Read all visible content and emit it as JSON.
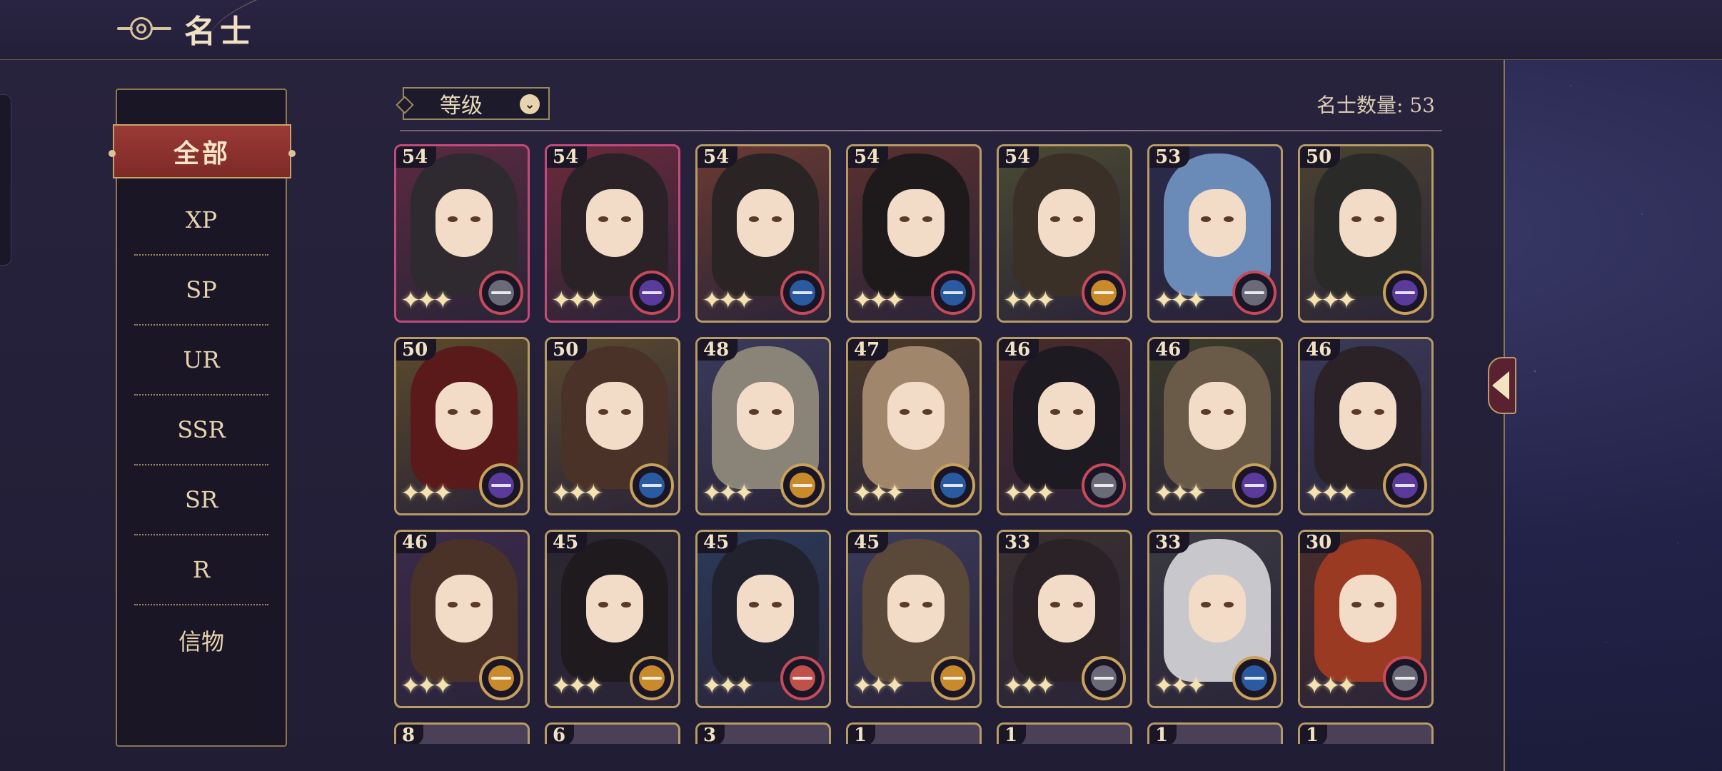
{
  "header": {
    "title": "名士"
  },
  "sidebar": {
    "items": [
      {
        "label": "全部",
        "active": true
      },
      {
        "label": "XP"
      },
      {
        "label": "SP"
      },
      {
        "label": "UR"
      },
      {
        "label": "SSR"
      },
      {
        "label": "SR"
      },
      {
        "label": "R"
      },
      {
        "label": "信物"
      }
    ]
  },
  "sort": {
    "label": "等级",
    "icon": "chevron-down-icon"
  },
  "count": {
    "text": "名士数量: 53"
  },
  "colors": {
    "accent": "#b79b64",
    "active_tab": "#8a302c",
    "badge_types": {
      "grey": "#6a6a78",
      "purple": "#5a3a9a",
      "blue": "#2a5aa0",
      "gold": "#c88a2a",
      "red": "#c0504a"
    }
  },
  "cards": [
    {
      "level": "54",
      "frame": "#c44a7a",
      "hair": "#2e2a30",
      "badge": "grey",
      "ring": "#c74a5a",
      "bg": "#5a2a40"
    },
    {
      "level": "54",
      "frame": "#c44a7a",
      "hair": "#2a2226",
      "badge": "purple",
      "ring": "#c74a5a",
      "bg": "#6a2a3a"
    },
    {
      "level": "54",
      "frame": "#b79b64",
      "hair": "#2a2424",
      "badge": "blue",
      "ring": "#c74a5a",
      "bg": "#6a3a32"
    },
    {
      "level": "54",
      "frame": "#b79b64",
      "hair": "#1e1a1c",
      "badge": "blue",
      "ring": "#c74a5a",
      "bg": "#5a3030"
    },
    {
      "level": "54",
      "frame": "#b79b64",
      "hair": "#3a3028",
      "badge": "gold",
      "ring": "#c74a5a",
      "bg": "#4a4a32"
    },
    {
      "level": "53",
      "frame": "#b79b64",
      "hair": "#6a8ab8",
      "badge": "grey",
      "ring": "#c74a5a",
      "bg": "#2a2a4a"
    },
    {
      "level": "50",
      "frame": "#b79b64",
      "hair": "#2a2a28",
      "badge": "purple",
      "ring": "#c8a25a",
      "bg": "#4a4230"
    },
    {
      "level": "50",
      "frame": "#b79b64",
      "hair": "#5a1a1a",
      "badge": "purple",
      "ring": "#c8a25a",
      "bg": "#5a4a2a"
    },
    {
      "level": "50",
      "frame": "#b79b64",
      "hair": "#4a3228",
      "badge": "blue",
      "ring": "#c8a25a",
      "bg": "#5a4a30"
    },
    {
      "level": "48",
      "frame": "#b79b64",
      "hair": "#8a8478",
      "badge": "gold",
      "ring": "#c8a25a",
      "bg": "#3a3a5a"
    },
    {
      "level": "47",
      "frame": "#b79b64",
      "hair": "#a0866a",
      "badge": "blue",
      "ring": "#c8a25a",
      "bg": "#4a3a2a"
    },
    {
      "level": "46",
      "frame": "#b79b64",
      "hair": "#1e1a22",
      "badge": "grey",
      "ring": "#c74a5a",
      "bg": "#4a2a2a"
    },
    {
      "level": "46",
      "frame": "#b79b64",
      "hair": "#6a5a48",
      "badge": "purple",
      "ring": "#c8a25a",
      "bg": "#3a3a2a"
    },
    {
      "level": "46",
      "frame": "#b79b64",
      "hair": "#2a2226",
      "badge": "purple",
      "ring": "#c8a25a",
      "bg": "#3a3a5a"
    },
    {
      "level": "46",
      "frame": "#b79b64",
      "hair": "#4a3228",
      "badge": "gold",
      "ring": "#c8a25a",
      "bg": "#3a2a4a"
    },
    {
      "level": "45",
      "frame": "#b79b64",
      "hair": "#1e1a1e",
      "badge": "gold",
      "ring": "#c8a25a",
      "bg": "#2a2630"
    },
    {
      "level": "45",
      "frame": "#b79b64",
      "hair": "#22222e",
      "badge": "red",
      "ring": "#c74a5a",
      "bg": "#2a3a5a"
    },
    {
      "level": "45",
      "frame": "#b79b64",
      "hair": "#5a4838",
      "badge": "gold",
      "ring": "#c8a25a",
      "bg": "#3a3a5a"
    },
    {
      "level": "33",
      "frame": "#b79b64",
      "hair": "#2a2226",
      "badge": "grey",
      "ring": "#c8a25a",
      "bg": "#3a3030"
    },
    {
      "level": "33",
      "frame": "#b79b64",
      "hair": "#c8c8cc",
      "badge": "blue",
      "ring": "#c8a25a",
      "bg": "#3a3a42"
    },
    {
      "level": "30",
      "frame": "#b79b64",
      "hair": "#9a3a22",
      "badge": "grey",
      "ring": "#c74a5a",
      "bg": "#4a2e2a"
    },
    {
      "level": "8",
      "frame": "#b79b64",
      "partial": true
    },
    {
      "level": "6",
      "frame": "#b79b64",
      "partial": true
    },
    {
      "level": "3",
      "frame": "#b79b64",
      "partial": true
    },
    {
      "level": "1",
      "frame": "#b79b64",
      "partial": true
    },
    {
      "level": "1",
      "frame": "#b79b64",
      "partial": true
    },
    {
      "level": "1",
      "frame": "#b79b64",
      "partial": true
    },
    {
      "level": "1",
      "frame": "#b79b64",
      "partial": true
    }
  ]
}
